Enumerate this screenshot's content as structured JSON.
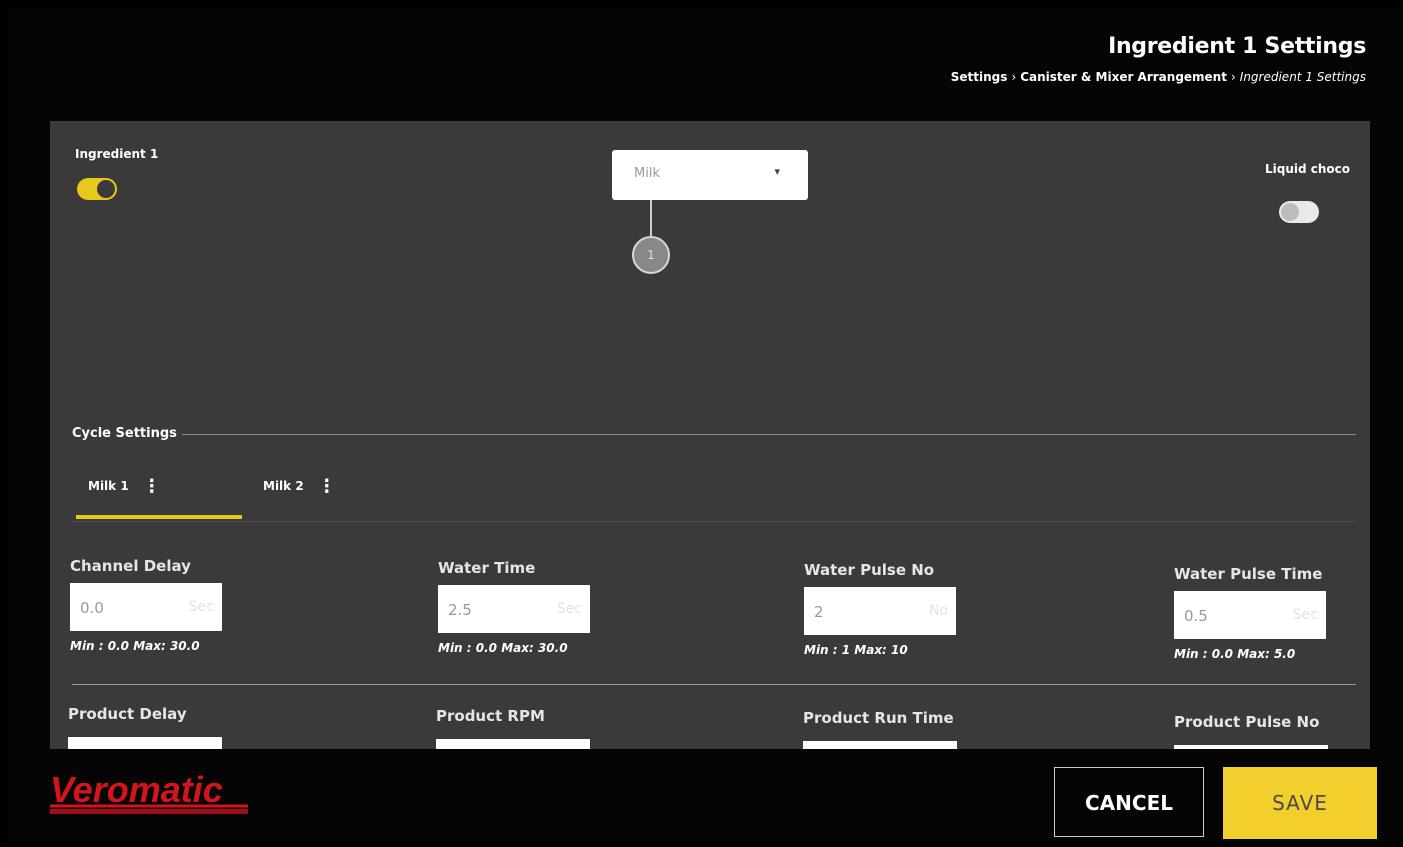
{
  "header": {
    "title": "Ingredient 1 Settings",
    "breadcrumb": {
      "items": [
        "Settings",
        "Canister & Mixer Arrangement"
      ],
      "current": "Ingredient 1 Settings",
      "separator": "›"
    }
  },
  "ingredient": {
    "label": "Ingredient 1",
    "toggle_on": true,
    "select_value": "Milk",
    "node_number": "1"
  },
  "liquid_choco": {
    "label": "Liquid choco",
    "toggle_on": false
  },
  "cycle_settings": {
    "label": "Cycle Settings",
    "tabs": [
      {
        "label": "Milk 1",
        "active": true
      },
      {
        "label": "Milk 2",
        "active": false
      }
    ]
  },
  "fields": [
    {
      "label": "Channel Delay",
      "value": "0.0",
      "unit": "Sec",
      "hint": "Min : 0.0 Max: 30.0"
    },
    {
      "label": "Water Time",
      "value": "2.5",
      "unit": "Sec",
      "hint": "Min : 0.0 Max: 30.0"
    },
    {
      "label": "Water Pulse No",
      "value": "2",
      "unit": "No",
      "hint": "Min : 1 Max: 10"
    },
    {
      "label": "Water Pulse Time",
      "value": "0.5",
      "unit": "Sec",
      "hint": "Min : 0.0 Max: 5.0"
    }
  ],
  "fields2": [
    {
      "label": "Product Delay"
    },
    {
      "label": "Product RPM"
    },
    {
      "label": "Product Run Time"
    },
    {
      "label": "Product Pulse No"
    }
  ],
  "footer": {
    "logo_text": "Veromatic",
    "logo_tagline": "",
    "cancel_label": "CANCEL",
    "save_label": "SAVE"
  },
  "colors": {
    "accent": "#e8c81a",
    "save_bg": "#f2cf2d",
    "panel_bg": "#3a3a3a",
    "logo_red": "#d4141c"
  }
}
